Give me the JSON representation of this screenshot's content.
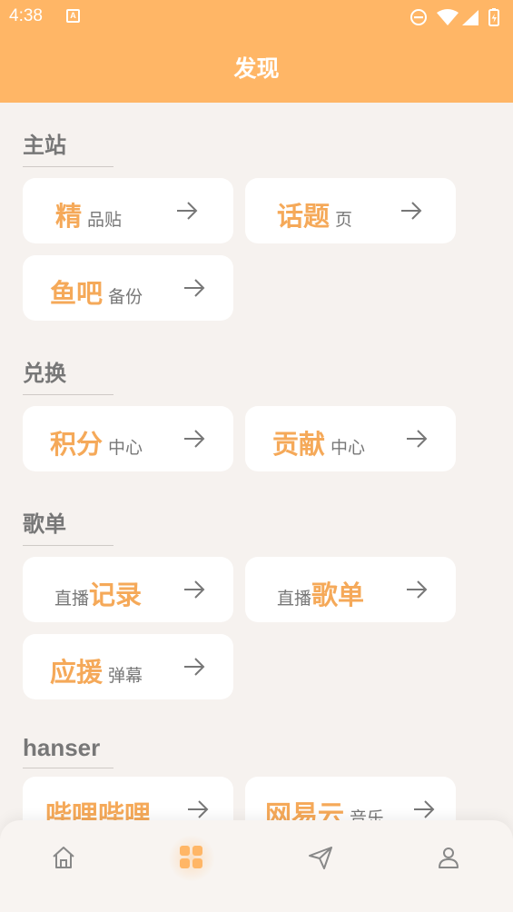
{
  "status_bar": {
    "time": "4:38",
    "notification_icon_label": "A"
  },
  "header": {
    "title": "发现"
  },
  "sections": [
    {
      "title": "主站",
      "cards": [
        {
          "big": "精",
          "small": "品贴",
          "order": "big-first"
        },
        {
          "big": "话题",
          "small": "页",
          "order": "big-first"
        },
        {
          "big": "鱼吧",
          "small": "备份",
          "order": "big-first"
        }
      ]
    },
    {
      "title": "兑换",
      "cards": [
        {
          "big": "积分",
          "small": "中心",
          "order": "big-first"
        },
        {
          "big": "贡献",
          "small": "中心",
          "order": "big-first"
        }
      ]
    },
    {
      "title": "歌单",
      "cards": [
        {
          "big": "记录",
          "small": "直播",
          "order": "small-first"
        },
        {
          "big": "歌单",
          "small": "直播",
          "order": "small-first"
        },
        {
          "big": "应援",
          "small": "弹幕",
          "order": "big-first"
        }
      ]
    },
    {
      "title": "hanser",
      "cards": [
        {
          "big": "哔哩哔哩",
          "small": "",
          "order": "big-first"
        },
        {
          "big": "网易云",
          "small": "音乐",
          "order": "big-first"
        }
      ]
    }
  ],
  "bottom_nav": [
    {
      "icon": "home-icon",
      "active": false
    },
    {
      "icon": "grid-icon",
      "active": true
    },
    {
      "icon": "send-icon",
      "active": false
    },
    {
      "icon": "user-icon",
      "active": false
    }
  ],
  "colors": {
    "accent": "#ffb666",
    "accent_text": "#f5a959",
    "background": "#f6f2ef",
    "card": "#ffffff",
    "muted_text": "#777777"
  }
}
